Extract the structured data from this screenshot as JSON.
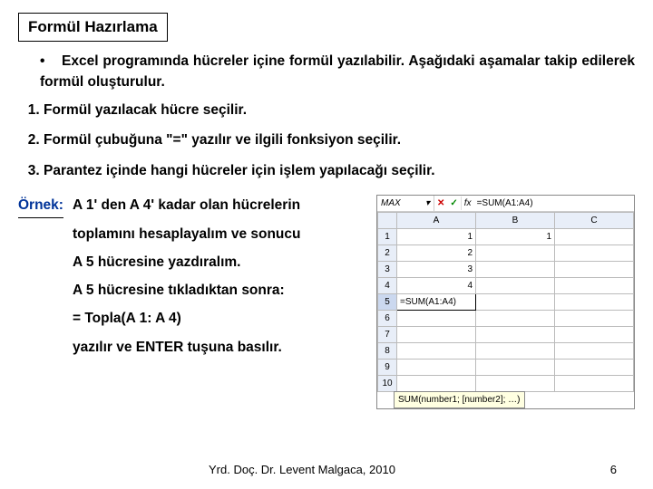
{
  "title": "Formül Hazırlama",
  "intro": "Excel programında hücreler içine formül yazılabilir. Aşağıdaki aşamalar takip edilerek formül oluşturulur.",
  "steps": [
    "Formül yazılacak hücre seçilir.",
    "Formül çubuğuna \"=\" yazılır ve ilgili fonksiyon seçilir.",
    "Parantez içinde hangi hücreler için işlem yapılacağı seçilir."
  ],
  "example": {
    "label": "Örnek:",
    "lines": [
      "A 1' den A 4' kadar olan hücrelerin",
      "toplamını hesaplayalım ve sonucu",
      "A 5 hücresine yazdıralım.",
      "A 5 hücresine tıkladıktan sonra:",
      "= Topla(A 1: A 4)",
      "yazılır ve ENTER tuşuna basılır."
    ]
  },
  "excel": {
    "namebox": "MAX",
    "dropdown": "▾",
    "xmark": "✕",
    "check": "✓",
    "fx": "fx",
    "formula": "=SUM(A1:A4)",
    "columns": [
      "A",
      "B",
      "C"
    ],
    "rows": [
      "1",
      "2",
      "3",
      "4",
      "5",
      "6",
      "7",
      "8",
      "9",
      "10"
    ],
    "cells": {
      "A1": "1",
      "A2": "2",
      "A3": "3",
      "A4": "4",
      "A5": "=SUM(A1:A4)",
      "B1": "1"
    },
    "tooltip": "SUM(number1; [number2]; …)"
  },
  "footer": {
    "author": "Yrd. Doç. Dr. Levent Malgaca, 2010",
    "page": "6"
  }
}
